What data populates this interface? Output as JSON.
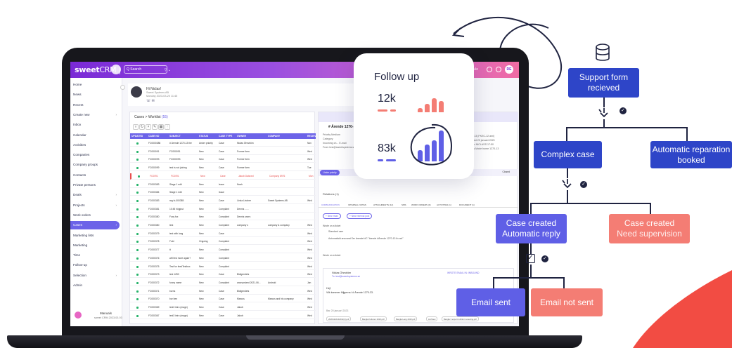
{
  "crm": {
    "logo_bold": "sweet",
    "logo_light": "CRM",
    "logo_sep": "|",
    "search_placeholder": "Q Search",
    "user_initials": "DE",
    "module_label": "Module",
    "sidebar": [
      {
        "label": "Home"
      },
      {
        "label": "News"
      },
      {
        "label": "Recent"
      },
      {
        "label": "Create new",
        "chev": "›"
      },
      {
        "label": "Inbox"
      },
      {
        "label": "Calendar"
      },
      {
        "label": "Activities"
      },
      {
        "label": "Companies"
      },
      {
        "label": "Company groups"
      },
      {
        "label": "Contacts"
      },
      {
        "label": "Private persons"
      },
      {
        "label": "Deals",
        "chev": "›"
      },
      {
        "label": "Projects",
        "chev": "›"
      },
      {
        "label": "Work orders"
      },
      {
        "label": "Cases",
        "chev": "›",
        "active": true
      },
      {
        "label": "Marketing lists"
      },
      {
        "label": "Marketing"
      },
      {
        "label": "Time"
      },
      {
        "label": "Follow-up"
      },
      {
        "label": "Selection",
        "chev": "›"
      },
      {
        "label": "Admin"
      }
    ],
    "footer_name": "Manuals",
    "footer_version": "sweet CRM 2023.03.03",
    "user_card": {
      "greeting": "Hi Niclas!",
      "sub": "Sweet Systems AB",
      "date": "Monday 2023-03-20 11:45"
    },
    "breadcrumb": "Cases > Worklist",
    "breadcrumb_count": "(55)",
    "table_headers": [
      "UPDATED",
      "CASE NO",
      "SUBJECT",
      "STATUS",
      "CASE TYPE",
      "OWNER",
      "COMPANY",
      "RECEIV"
    ],
    "rows": [
      {
        "no": "FC0000386",
        "subject": "# Ärende 1270-13 the",
        "status": "Under priority",
        "type": "Case",
        "owner": "Niclas Öhrström",
        "company": "",
        "rcv": "Nov"
      },
      {
        "no": "FC000091",
        "subject": "FC000091",
        "status": "New",
        "type": "Case",
        "owner": "Former item",
        "company": "",
        "rcv": "Wed"
      },
      {
        "no": "FC000093",
        "subject": "FC000093",
        "status": "New",
        "type": "Case",
        "owner": "Former item",
        "company": "",
        "rcv": "Wed"
      },
      {
        "no": "FC000099",
        "subject": "test is not joining",
        "status": "New",
        "type": "Case",
        "owner": "Former item",
        "company": "",
        "rcv": "Tue"
      },
      {
        "no": "FC0091",
        "subject": "FC0091",
        "status": "New",
        "type": "Case",
        "owner": "Jakob Dalsved",
        "company": "Company 8976",
        "rcv": "Mon",
        "red": true
      },
      {
        "no": "FC000383",
        "subject": "Stage 1 edit",
        "status": "New",
        "type": "Issue",
        "owner": "Noah",
        "company": "",
        "rcv": ""
      },
      {
        "no": "FC000384",
        "subject": "Stage 1 edit",
        "status": "New",
        "type": "Issue",
        "owner": "",
        "company": "",
        "rcv": ""
      },
      {
        "no": "FC000383",
        "subject": "reg fc-000385",
        "status": "New",
        "type": "Case",
        "owner": "Linda Lindner",
        "company": "Sweet Systems AB",
        "rcv": "Wed"
      },
      {
        "no": "FC000381",
        "subject": "10:45 högjust",
        "status": "New",
        "type": "Complaint",
        "owner": "Dennis ......",
        "company": "",
        "rcv": ""
      },
      {
        "no": "FC000380",
        "subject": "Foxy fox",
        "status": "New",
        "type": "Complaint",
        "owner": "Dennis users",
        "company": "",
        "rcv": ""
      },
      {
        "no": "FC000380",
        "subject": "test",
        "status": "New",
        "type": "Complaint",
        "owner": "company s",
        "company": "company & company",
        "rcv": "Wed"
      },
      {
        "no": "FC000379",
        "subject": "test with long",
        "status": "New",
        "type": "Case",
        "owner": "",
        "company": "",
        "rcv": "Wed"
      },
      {
        "no": "FC000378",
        "subject": "Fold",
        "status": "Ongoing",
        "type": "Complaint",
        "owner": "",
        "company": "",
        "rcv": "Wed"
      },
      {
        "no": "FC000377",
        "subject": "tt",
        "status": "New",
        "type": "Complaint",
        "owner": "",
        "company": "",
        "rcv": "Wed"
      },
      {
        "no": "FC000376",
        "subject": "will test more again?",
        "status": "New",
        "type": "Complaint",
        "owner": "",
        "company": "",
        "rcv": "Wed"
      },
      {
        "no": "FC000375",
        "subject": "Test for feedTestbox",
        "status": "New",
        "type": "Complaint",
        "owner": "",
        "company": "",
        "rcv": "Wed"
      },
      {
        "no": "FC000373",
        "subject": "test 1250",
        "status": "New",
        "type": "Case",
        "owner": "Bidigendets",
        "company": "",
        "rcv": "Wed"
      },
      {
        "no": "FC000372",
        "subject": "funny name",
        "status": "New",
        "type": "Complaint",
        "owner": "anonymized 2021-06...",
        "company": "Android",
        "rcv": "Jan"
      },
      {
        "no": "FC000371",
        "subject": "burns",
        "status": "New",
        "type": "Case",
        "owner": "Bidigendets",
        "company": "",
        "rcv": "Wed"
      },
      {
        "no": "FC000370",
        "subject": "bor ben",
        "status": "New",
        "type": "Case",
        "owner": "Marcus",
        "company": "Marcus and his company",
        "rcv": "Wed"
      },
      {
        "no": "FC000369",
        "subject": "test3 intro (mage)",
        "status": "New",
        "type": "Case",
        "owner": "Jakob",
        "company": "",
        "rcv": "Wed"
      },
      {
        "no": "FC000367",
        "subject": "test3 intro (mage)",
        "status": "New",
        "type": "Case",
        "owner": "Jakob",
        "company": "",
        "rcv": "Wed"
      }
    ],
    "detail": {
      "title": "# Ärende 1270-13",
      "meta": [
        "Priority     Medium",
        "Category",
        "Incoming ch...  E-mail",
        "From       test@sweetsystems.se"
      ],
      "meta_right": [
        "1270-13 (FKEC-12 aml)",
        "Created 20 januari 2023",
        "Owner   NICLASS  17:50",
        "Status  Mode home 1270-13"
      ],
      "pill": "Under priority",
      "closed": "Closed",
      "relations": "Relations (1)",
      "tabs": [
        "COMMUNICATION",
        "INTERNAL NOTES",
        "ATTACHMENTS (12)",
        "SMS",
        "WORK ORDERS (0)",
        "ACTIVITIES (1)",
        "DOCUMENT (1)"
      ],
      "btn_new_email": "+ New email",
      "btn_new_note": "+ New external post",
      "note_lines": [
        "Wrote on a ticket",
        "Standard user",
        "Automatiskt ansvarat Ser ärendet #C \"ärende #Ärende 1270-13 fix anl\"",
        "Wrote on a ticket"
      ],
      "email_from": "Niclas Öhrström",
      "email_to": "To: test@sweetsystems.se",
      "email_tag": "WROTE EMAIL IN: INBOUND",
      "email_greet": "Hej!",
      "email_line": "Vilk kommer följgerna i # Ärende 1270-33.",
      "email_date": "Bar 20 januari 2023",
      "chips": [
        "20201116142012(4).pdf",
        "Bangla Kulturen 2023.pdf",
        "Bangla Lang 2023.pdf",
        "ListView",
        "Bangla 3 export rubriknr renewing.pdf"
      ]
    }
  },
  "followup_card": {
    "title": "Follow up",
    "value1": "12k",
    "value2": "83k",
    "colors": {
      "coral": "#f47d74",
      "violet": "#5f5fe6"
    }
  },
  "flow": {
    "support_form": [
      "Support form",
      "recieved"
    ],
    "complex_case": "Complex case",
    "automatic_reparation": [
      "Automatic reparation",
      "booked"
    ],
    "case_created_auto": [
      "Case created",
      "Automatic reply"
    ],
    "case_created_super": [
      "Case created",
      "Need supervision"
    ],
    "email_sent": "Email sent",
    "email_not_sent": "Email not sent",
    "colors": {
      "navy": "#2e45c8",
      "violet": "#5f5fe6",
      "salmon": "#f47d74",
      "dark": "#1f2340"
    }
  }
}
